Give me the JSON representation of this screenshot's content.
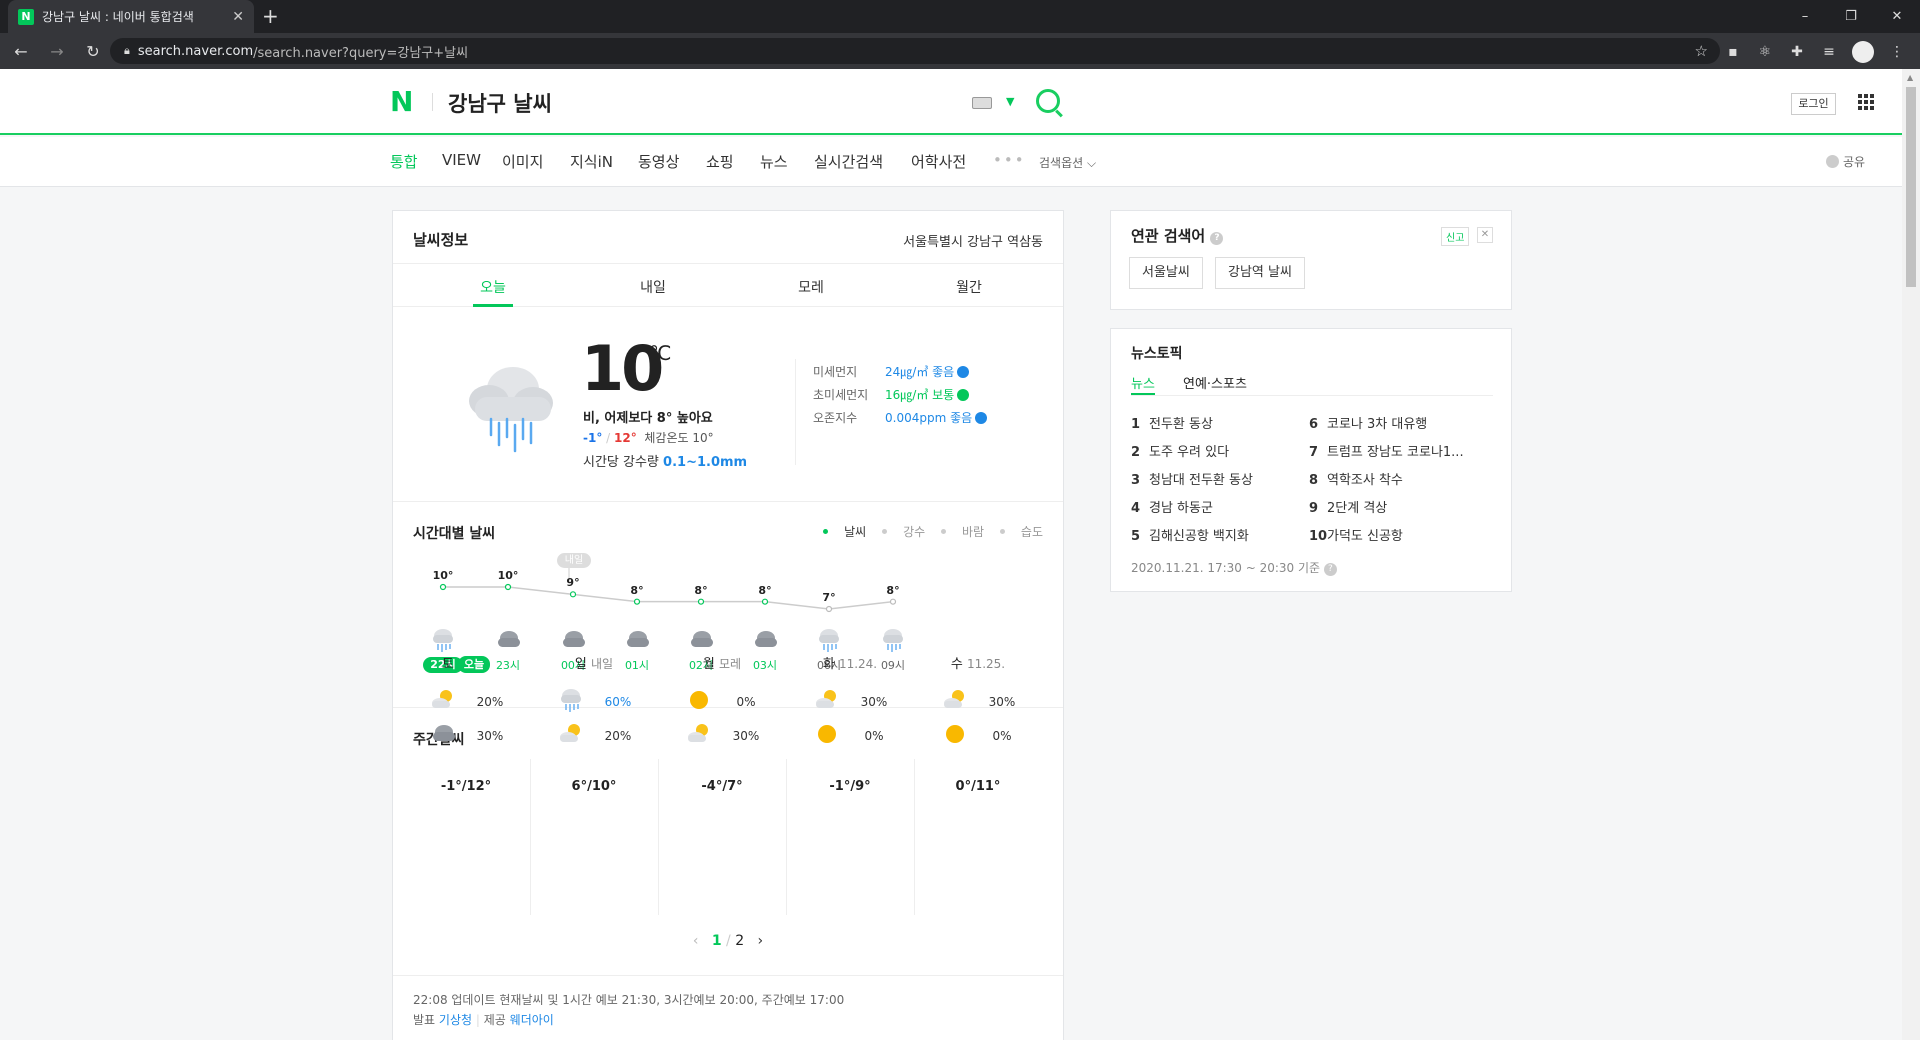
{
  "browser": {
    "tab_title": "강남구 날씨 : 네이버 통합검색",
    "tab_favicon": "N",
    "url_host": "search.naver.com",
    "url_path": "/search.naver?query=강남구+날씨",
    "window_controls": [
      "–",
      "❐",
      "✕"
    ]
  },
  "header": {
    "logo": "N",
    "query": "강남구 날씨",
    "login_label": "로그인"
  },
  "lnb": {
    "items": [
      {
        "label": "통합",
        "active": true
      },
      {
        "label": "VIEW"
      },
      {
        "label": "이미지"
      },
      {
        "label": "지식iN"
      },
      {
        "label": "동영상"
      },
      {
        "label": "쇼핑"
      },
      {
        "label": "뉴스"
      },
      {
        "label": "실시간검색"
      },
      {
        "label": "어학사전"
      }
    ],
    "more": "•••",
    "options": "검색옵션 ⌵",
    "share": "공유"
  },
  "weather": {
    "title": "날씨정보",
    "location": "서울특별시 강남구 역삼동",
    "tabs": [
      "오늘",
      "내일",
      "모레",
      "월간"
    ],
    "current": {
      "temp": "10",
      "unit": "℃",
      "summary": "비, 어제보다 8° 높아요",
      "min": "-1°",
      "max": "12°",
      "feels": "체감온도 10°",
      "rain_label": "시간당 강수량",
      "rain_value": "0.1~1.0mm"
    },
    "air": [
      {
        "label": "미세먼지",
        "value": "24㎍/㎥ 좋음",
        "color": "#1e88e5"
      },
      {
        "label": "초미세먼지",
        "value": "16㎍/㎥ 보통",
        "color": "#03c75a"
      },
      {
        "label": "오존지수",
        "value": "0.004ppm 좋음",
        "color": "#1e88e5"
      }
    ],
    "hourly_title": "시간대별 날씨",
    "hourly_legend": [
      "날씨",
      "강수",
      "바람",
      "습도"
    ],
    "tomorrow_tag": "내일",
    "hourly": [
      {
        "time": "22시",
        "temp": 10,
        "temp_label": "10°",
        "icon": "rain-cloud-icon"
      },
      {
        "time": "23시",
        "temp": 10,
        "temp_label": "10°",
        "icon": "cloud-icon"
      },
      {
        "time": "00시",
        "temp": 9,
        "temp_label": "9°",
        "icon": "cloud-icon"
      },
      {
        "time": "01시",
        "temp": 8,
        "temp_label": "8°",
        "icon": "cloud-icon"
      },
      {
        "time": "02시",
        "temp": 8,
        "temp_label": "8°",
        "icon": "cloud-icon"
      },
      {
        "time": "03시",
        "temp": 8,
        "temp_label": "8°",
        "icon": "cloud-icon"
      },
      {
        "time": "06시",
        "temp": 7,
        "temp_label": "7°",
        "icon": "rain-cloud-icon"
      },
      {
        "time": "09시",
        "temp": 8,
        "temp_label": "8°",
        "icon": "rain-cloud-icon"
      }
    ],
    "weekly_title": "주간날씨",
    "weekly": [
      {
        "day": "토",
        "sub": "오늘",
        "badge": true,
        "am_icon": "partly-cloudy-icon",
        "am": "20%",
        "pm_icon": "cloud-icon",
        "pm": "30%",
        "temps": "-1°/12°"
      },
      {
        "day": "일",
        "sub": "내일",
        "am_icon": "rain-cloud-icon",
        "am": "60%",
        "am_blue": true,
        "pm_icon": "partly-cloudy-icon",
        "pm": "20%",
        "temps": "6°/10°"
      },
      {
        "day": "월",
        "sub": "모레",
        "am_icon": "sun-icon",
        "am": "0%",
        "pm_icon": "partly-cloudy-icon",
        "pm": "30%",
        "temps": "-4°/7°"
      },
      {
        "day": "화",
        "sub": "11.24.",
        "am_icon": "partly-cloudy-icon",
        "am": "30%",
        "pm_icon": "sun-icon",
        "pm": "0%",
        "temps": "-1°/9°"
      },
      {
        "day": "수",
        "sub": "11.25.",
        "am_icon": "partly-cloudy-icon",
        "am": "30%",
        "pm_icon": "sun-icon",
        "pm": "0%",
        "temps": "0°/11°"
      }
    ],
    "pager": {
      "current": "1",
      "sep": "/",
      "total": "2"
    },
    "update_text": "22:08 업데이트 현재날씨 및 1시간 예보 21:30, 3시간예보 20:00, 주간예보 17:00",
    "source_label": "발표",
    "source_value": "기상청",
    "provider_label": "제공",
    "provider_value": "웨더아이"
  },
  "related": {
    "title": "연관 검색어",
    "report": "신고",
    "chips": [
      "서울날씨",
      "강남역 날씨"
    ]
  },
  "news": {
    "title": "뉴스토픽",
    "tabs": [
      "뉴스",
      "연예·스포츠"
    ],
    "items": [
      {
        "rank": "1",
        "text": "전두환 동상"
      },
      {
        "rank": "2",
        "text": "도주 우려 있다"
      },
      {
        "rank": "3",
        "text": "청남대 전두환 동상"
      },
      {
        "rank": "4",
        "text": "경남 하동군"
      },
      {
        "rank": "5",
        "text": "김해신공항 백지화"
      },
      {
        "rank": "6",
        "text": "코로나 3차 대유행"
      },
      {
        "rank": "7",
        "text": "트럼프 장남도 코로나1..."
      },
      {
        "rank": "8",
        "text": "역학조사 착수"
      },
      {
        "rank": "9",
        "text": "2단계 격상"
      },
      {
        "rank": "10",
        "text": "가덕도 신공항"
      }
    ],
    "timestamp": "2020.11.21. 17:30 ~ 20:30 기준"
  }
}
